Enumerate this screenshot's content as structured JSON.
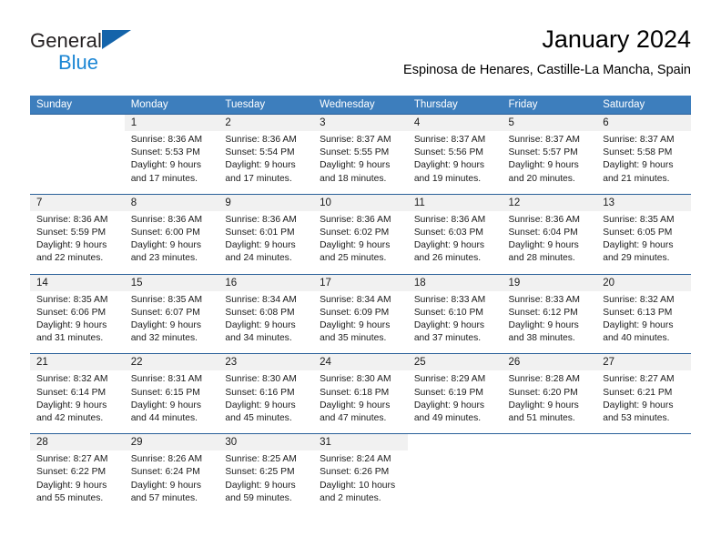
{
  "brand": {
    "name_top": "General",
    "name_bottom": "Blue",
    "triangle_color": "#1464aa",
    "blue_color": "#1b86d4"
  },
  "header": {
    "title": "January 2024",
    "subtitle": "Espinosa de Henares, Castille-La Mancha, Spain"
  },
  "theme": {
    "header_blue": "#3d7ebd",
    "rule_blue": "#2a6099",
    "daynum_band": "#f1f1f1"
  },
  "weekdays": [
    "Sunday",
    "Monday",
    "Tuesday",
    "Wednesday",
    "Thursday",
    "Friday",
    "Saturday"
  ],
  "weeks": [
    {
      "days": [
        {
          "num": "",
          "lines": [
            "",
            "",
            "",
            ""
          ]
        },
        {
          "num": "1",
          "lines": [
            "Sunrise: 8:36 AM",
            "Sunset: 5:53 PM",
            "Daylight: 9 hours",
            "and 17 minutes."
          ]
        },
        {
          "num": "2",
          "lines": [
            "Sunrise: 8:36 AM",
            "Sunset: 5:54 PM",
            "Daylight: 9 hours",
            "and 17 minutes."
          ]
        },
        {
          "num": "3",
          "lines": [
            "Sunrise: 8:37 AM",
            "Sunset: 5:55 PM",
            "Daylight: 9 hours",
            "and 18 minutes."
          ]
        },
        {
          "num": "4",
          "lines": [
            "Sunrise: 8:37 AM",
            "Sunset: 5:56 PM",
            "Daylight: 9 hours",
            "and 19 minutes."
          ]
        },
        {
          "num": "5",
          "lines": [
            "Sunrise: 8:37 AM",
            "Sunset: 5:57 PM",
            "Daylight: 9 hours",
            "and 20 minutes."
          ]
        },
        {
          "num": "6",
          "lines": [
            "Sunrise: 8:37 AM",
            "Sunset: 5:58 PM",
            "Daylight: 9 hours",
            "and 21 minutes."
          ]
        }
      ]
    },
    {
      "days": [
        {
          "num": "7",
          "lines": [
            "Sunrise: 8:36 AM",
            "Sunset: 5:59 PM",
            "Daylight: 9 hours",
            "and 22 minutes."
          ]
        },
        {
          "num": "8",
          "lines": [
            "Sunrise: 8:36 AM",
            "Sunset: 6:00 PM",
            "Daylight: 9 hours",
            "and 23 minutes."
          ]
        },
        {
          "num": "9",
          "lines": [
            "Sunrise: 8:36 AM",
            "Sunset: 6:01 PM",
            "Daylight: 9 hours",
            "and 24 minutes."
          ]
        },
        {
          "num": "10",
          "lines": [
            "Sunrise: 8:36 AM",
            "Sunset: 6:02 PM",
            "Daylight: 9 hours",
            "and 25 minutes."
          ]
        },
        {
          "num": "11",
          "lines": [
            "Sunrise: 8:36 AM",
            "Sunset: 6:03 PM",
            "Daylight: 9 hours",
            "and 26 minutes."
          ]
        },
        {
          "num": "12",
          "lines": [
            "Sunrise: 8:36 AM",
            "Sunset: 6:04 PM",
            "Daylight: 9 hours",
            "and 28 minutes."
          ]
        },
        {
          "num": "13",
          "lines": [
            "Sunrise: 8:35 AM",
            "Sunset: 6:05 PM",
            "Daylight: 9 hours",
            "and 29 minutes."
          ]
        }
      ]
    },
    {
      "days": [
        {
          "num": "14",
          "lines": [
            "Sunrise: 8:35 AM",
            "Sunset: 6:06 PM",
            "Daylight: 9 hours",
            "and 31 minutes."
          ]
        },
        {
          "num": "15",
          "lines": [
            "Sunrise: 8:35 AM",
            "Sunset: 6:07 PM",
            "Daylight: 9 hours",
            "and 32 minutes."
          ]
        },
        {
          "num": "16",
          "lines": [
            "Sunrise: 8:34 AM",
            "Sunset: 6:08 PM",
            "Daylight: 9 hours",
            "and 34 minutes."
          ]
        },
        {
          "num": "17",
          "lines": [
            "Sunrise: 8:34 AM",
            "Sunset: 6:09 PM",
            "Daylight: 9 hours",
            "and 35 minutes."
          ]
        },
        {
          "num": "18",
          "lines": [
            "Sunrise: 8:33 AM",
            "Sunset: 6:10 PM",
            "Daylight: 9 hours",
            "and 37 minutes."
          ]
        },
        {
          "num": "19",
          "lines": [
            "Sunrise: 8:33 AM",
            "Sunset: 6:12 PM",
            "Daylight: 9 hours",
            "and 38 minutes."
          ]
        },
        {
          "num": "20",
          "lines": [
            "Sunrise: 8:32 AM",
            "Sunset: 6:13 PM",
            "Daylight: 9 hours",
            "and 40 minutes."
          ]
        }
      ]
    },
    {
      "days": [
        {
          "num": "21",
          "lines": [
            "Sunrise: 8:32 AM",
            "Sunset: 6:14 PM",
            "Daylight: 9 hours",
            "and 42 minutes."
          ]
        },
        {
          "num": "22",
          "lines": [
            "Sunrise: 8:31 AM",
            "Sunset: 6:15 PM",
            "Daylight: 9 hours",
            "and 44 minutes."
          ]
        },
        {
          "num": "23",
          "lines": [
            "Sunrise: 8:30 AM",
            "Sunset: 6:16 PM",
            "Daylight: 9 hours",
            "and 45 minutes."
          ]
        },
        {
          "num": "24",
          "lines": [
            "Sunrise: 8:30 AM",
            "Sunset: 6:18 PM",
            "Daylight: 9 hours",
            "and 47 minutes."
          ]
        },
        {
          "num": "25",
          "lines": [
            "Sunrise: 8:29 AM",
            "Sunset: 6:19 PM",
            "Daylight: 9 hours",
            "and 49 minutes."
          ]
        },
        {
          "num": "26",
          "lines": [
            "Sunrise: 8:28 AM",
            "Sunset: 6:20 PM",
            "Daylight: 9 hours",
            "and 51 minutes."
          ]
        },
        {
          "num": "27",
          "lines": [
            "Sunrise: 8:27 AM",
            "Sunset: 6:21 PM",
            "Daylight: 9 hours",
            "and 53 minutes."
          ]
        }
      ]
    },
    {
      "days": [
        {
          "num": "28",
          "lines": [
            "Sunrise: 8:27 AM",
            "Sunset: 6:22 PM",
            "Daylight: 9 hours",
            "and 55 minutes."
          ]
        },
        {
          "num": "29",
          "lines": [
            "Sunrise: 8:26 AM",
            "Sunset: 6:24 PM",
            "Daylight: 9 hours",
            "and 57 minutes."
          ]
        },
        {
          "num": "30",
          "lines": [
            "Sunrise: 8:25 AM",
            "Sunset: 6:25 PM",
            "Daylight: 9 hours",
            "and 59 minutes."
          ]
        },
        {
          "num": "31",
          "lines": [
            "Sunrise: 8:24 AM",
            "Sunset: 6:26 PM",
            "Daylight: 10 hours",
            "and 2 minutes."
          ]
        },
        {
          "num": "",
          "lines": [
            "",
            "",
            "",
            ""
          ]
        },
        {
          "num": "",
          "lines": [
            "",
            "",
            "",
            ""
          ]
        },
        {
          "num": "",
          "lines": [
            "",
            "",
            "",
            ""
          ]
        }
      ]
    }
  ]
}
